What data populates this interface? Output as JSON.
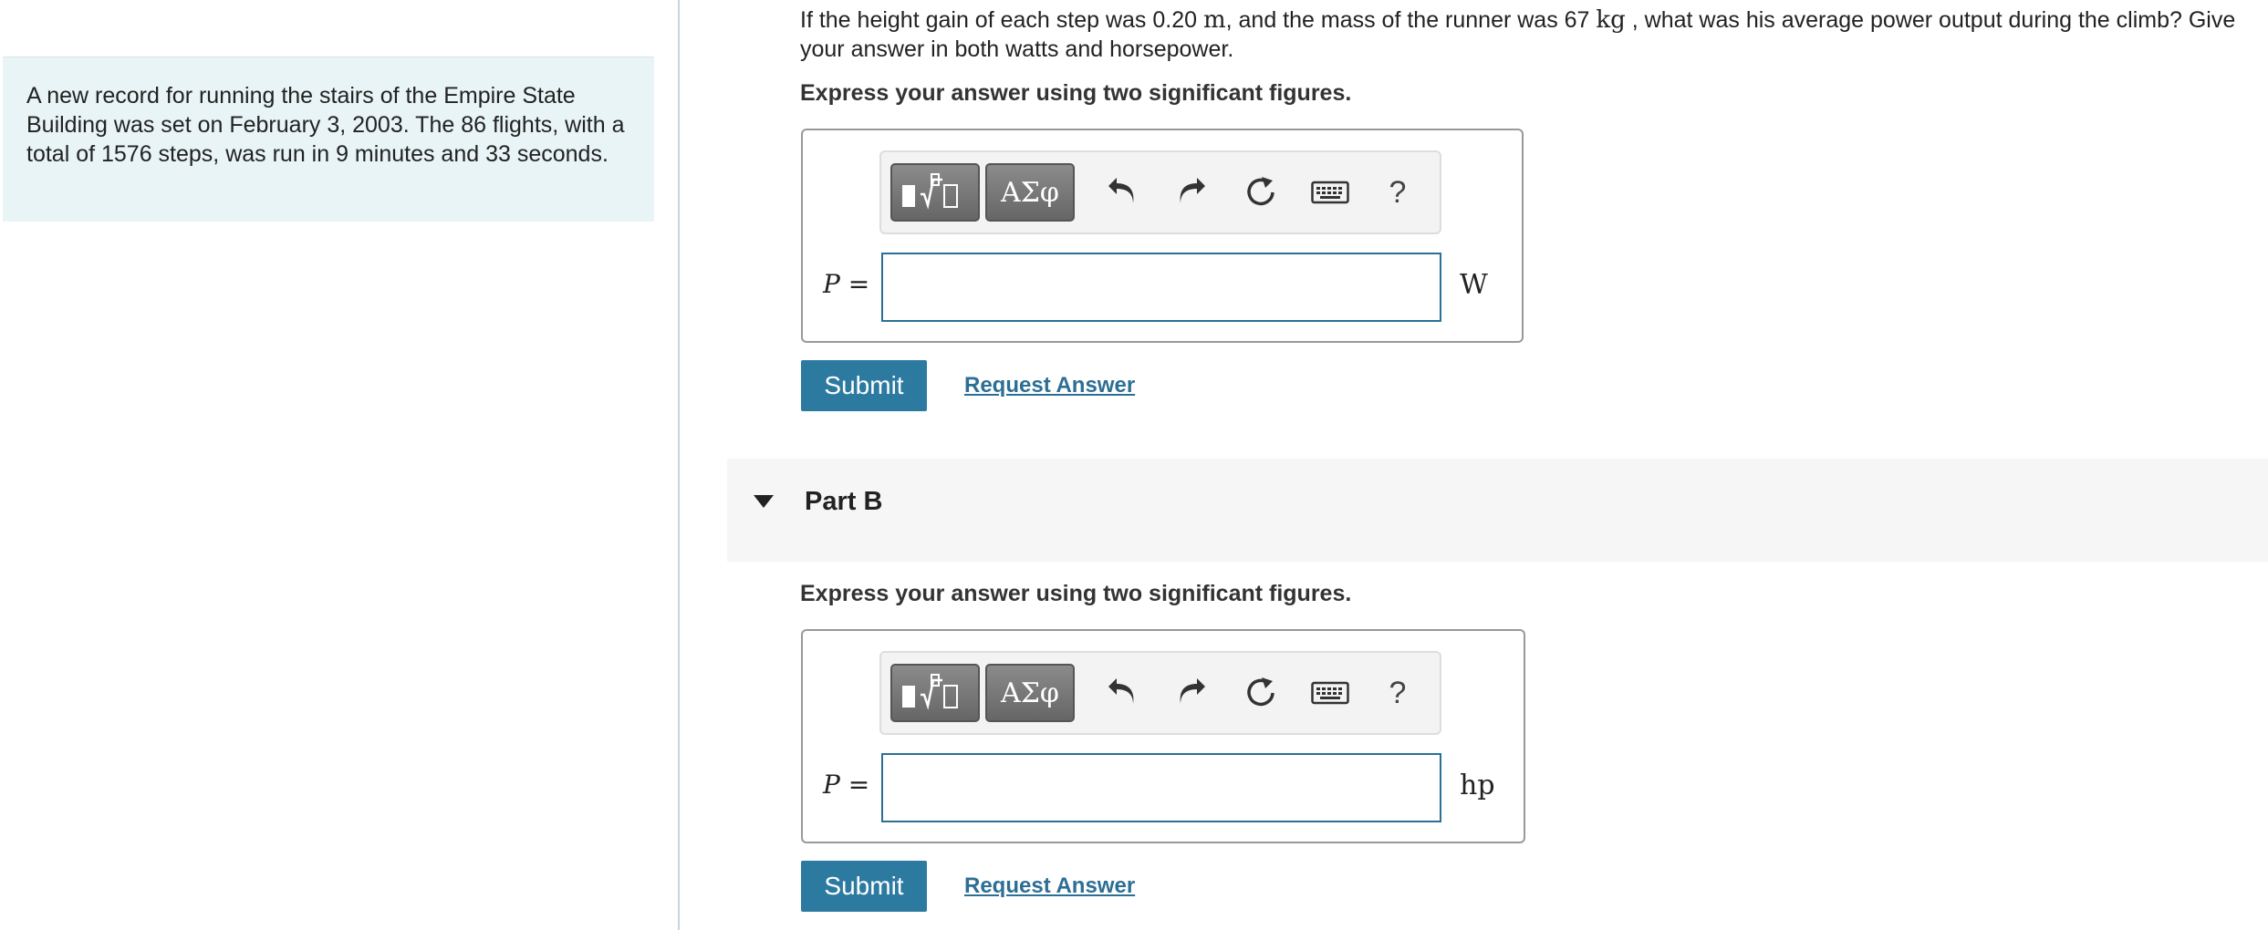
{
  "problem": {
    "intro": "A new record for running the stairs of the Empire State Building was set on February 3, 2003. The 86 flights, with a total of 1576 steps, was run in 9 minutes and 33 seconds."
  },
  "part_a": {
    "question_pre": "If the height gain of each step was 0.20 ",
    "question_unit_m": "m",
    "question_mid": ", and the mass of the runner was 67 ",
    "question_unit_kg": "kg",
    "question_post": " , what was his average power output during the climb? Give your answer in both watts and horsepower.",
    "instruction": "Express your answer using two significant figures.",
    "var_label": "P",
    "equals": "=",
    "input_value": "",
    "unit": "W",
    "submit_label": "Submit",
    "request_label": "Request Answer"
  },
  "part_b": {
    "title": "Part B",
    "instruction": "Express your answer using two significant figures.",
    "var_label": "P",
    "equals": "=",
    "input_value": "",
    "unit": "hp",
    "submit_label": "Submit",
    "request_label": "Request Answer"
  },
  "toolbar": {
    "greek_label": "ΑΣφ",
    "help_label": "?",
    "icons": [
      "templates-icon",
      "greek-symbols-icon",
      "undo-icon",
      "redo-icon",
      "reset-icon",
      "keyboard-icon",
      "help-icon"
    ]
  },
  "colors": {
    "accent": "#2d7aa1",
    "link": "#2d6e95",
    "intro_bg": "#e8f4f6",
    "input_border": "#2a6f95"
  }
}
